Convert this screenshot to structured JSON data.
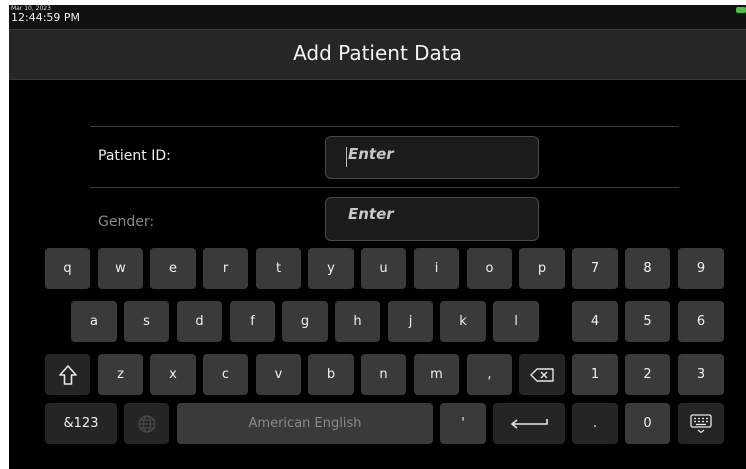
{
  "status": {
    "date": "Mar 10, 2023",
    "time": "12:44:59 PM",
    "battery_color": "#44c43c"
  },
  "header": {
    "title": "Add Patient Data"
  },
  "form": {
    "patient_id": {
      "label": "Patient ID:",
      "placeholder": "Enter"
    },
    "gender": {
      "label": "Gender:",
      "placeholder": "Enter"
    }
  },
  "keyboard": {
    "row1": [
      "q",
      "w",
      "e",
      "r",
      "t",
      "y",
      "u",
      "i",
      "o",
      "p"
    ],
    "row2": [
      "a",
      "s",
      "d",
      "f",
      "g",
      "h",
      "j",
      "k",
      "l"
    ],
    "row3": [
      "z",
      "x",
      "c",
      "v",
      "b",
      "n",
      "m",
      ","
    ],
    "num_row1": [
      "7",
      "8",
      "9"
    ],
    "num_row2": [
      "4",
      "5",
      "6"
    ],
    "num_row3": [
      "1",
      "2",
      "3"
    ],
    "symbols_label": "&123",
    "space_label": "American English",
    "apostrophe": "'",
    "period": ".",
    "zero": "0",
    "icons": [
      "shift-icon",
      "backspace-icon",
      "globe-icon",
      "enter-icon",
      "keyboard-hide-icon"
    ]
  }
}
